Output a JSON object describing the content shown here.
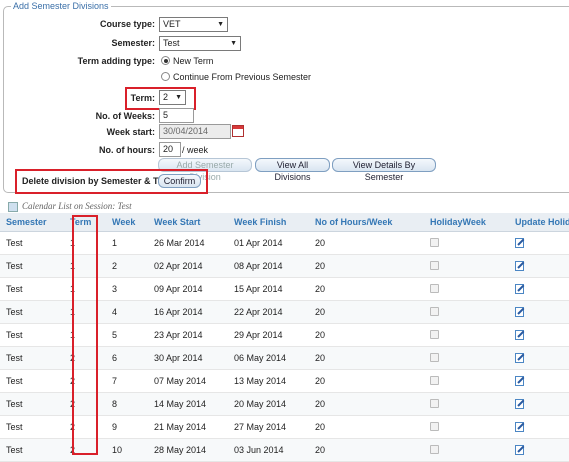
{
  "form": {
    "legend": "Add Semester Divisions",
    "course_type_label": "Course type:",
    "course_type_value": "VET",
    "semester_label": "Semester:",
    "semester_value": "Test",
    "term_adding_label": "Term adding type:",
    "radio_new_term": "New Term",
    "radio_continue": "Continue From Previous Semester",
    "term_label": "Term:",
    "term_value": "2",
    "weeks_label": "No. of Weeks:",
    "weeks_value": "5",
    "week_start_label": "Week start:",
    "week_start_value": "30/04/2014",
    "hours_label": "No. of hours:",
    "hours_value": "20",
    "hours_unit": "/ week",
    "btn_add": "Add Semester Division",
    "btn_view_all": "View All Divisions",
    "btn_view_details": "View Details By Semester",
    "delete_label": "Delete division by Semester & Term",
    "btn_confirm": "Confirm"
  },
  "calendar_list_label": "Calendar List on Session: Test",
  "table": {
    "headers": [
      "Semester",
      "Term",
      "Week",
      "Week Start",
      "Week Finish",
      "No of Hours/Week",
      "HolidayWeek",
      "Update Holiday"
    ],
    "rows": [
      [
        "Test",
        "1",
        "1",
        "26 Mar 2014",
        "01 Apr 2014",
        "20"
      ],
      [
        "Test",
        "1",
        "2",
        "02 Apr 2014",
        "08 Apr 2014",
        "20"
      ],
      [
        "Test",
        "1",
        "3",
        "09 Apr 2014",
        "15 Apr 2014",
        "20"
      ],
      [
        "Test",
        "1",
        "4",
        "16 Apr 2014",
        "22 Apr 2014",
        "20"
      ],
      [
        "Test",
        "1",
        "5",
        "23 Apr 2014",
        "29 Apr 2014",
        "20"
      ],
      [
        "Test",
        "2",
        "6",
        "30 Apr 2014",
        "06 May 2014",
        "20"
      ],
      [
        "Test",
        "2",
        "7",
        "07 May 2014",
        "13 May 2014",
        "20"
      ],
      [
        "Test",
        "2",
        "8",
        "14 May 2014",
        "20 May 2014",
        "20"
      ],
      [
        "Test",
        "2",
        "9",
        "21 May 2014",
        "27 May 2014",
        "20"
      ],
      [
        "Test",
        "2",
        "10",
        "28 May 2014",
        "03 Jun 2014",
        "20"
      ]
    ]
  },
  "colors": {
    "header_text": "#3477b5",
    "highlight_border": "#d9202a"
  }
}
